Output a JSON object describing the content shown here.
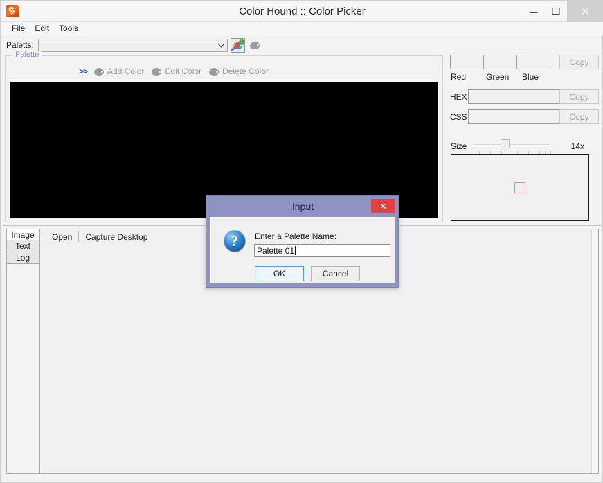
{
  "window": {
    "title": "Color Hound :: Color Picker",
    "icon": "app-dog-icon",
    "controls": {
      "minimize": "–",
      "maximize": "□",
      "close": "✕"
    }
  },
  "menubar": {
    "items": [
      "File",
      "Edit",
      "Tools"
    ]
  },
  "palette_bar": {
    "label": "Paletts:",
    "combo_value": "",
    "combo_arrow_icon": "chevron-down-icon",
    "buttons": [
      {
        "name": "new-palette-button",
        "icon": "palette-add-icon",
        "state": "active"
      },
      {
        "name": "delete-palette-button",
        "icon": "palette-icon",
        "state": "disabled"
      }
    ]
  },
  "palette_group": {
    "legend": "Palette",
    "expander": ">>",
    "actions": [
      {
        "label": "Add Color",
        "icon": "palette-icon",
        "enabled": false
      },
      {
        "label": "Edit Color",
        "icon": "palette-icon",
        "enabled": false
      },
      {
        "label": "Delete Color",
        "icon": "palette-icon",
        "enabled": false
      }
    ],
    "swatch_area_color": "#000000"
  },
  "color_panel": {
    "rgb": {
      "red": {
        "label": "Red",
        "value": ""
      },
      "green": {
        "label": "Green",
        "value": ""
      },
      "blue": {
        "label": "Blue",
        "value": ""
      },
      "copy_label": "Copy"
    },
    "hex": {
      "label": "HEX",
      "value": "",
      "copy_label": "Copy"
    },
    "css": {
      "label": "CSS",
      "value": "",
      "copy_label": "Copy"
    },
    "size": {
      "label": "Size",
      "value": "14x"
    },
    "preview": {
      "name": "magnifier-preview",
      "cursor_color": "#e08b8b"
    }
  },
  "bottom": {
    "vtabs": [
      {
        "label": "Image",
        "selected": true
      },
      {
        "label": "Text",
        "selected": false
      },
      {
        "label": "Log",
        "selected": false
      }
    ],
    "toolbar": [
      {
        "label": "Open"
      },
      {
        "label": "Capture Desktop"
      }
    ]
  },
  "dialog": {
    "title": "Input",
    "close_glyph": "✕",
    "icon": "question-icon",
    "icon_glyph": "?",
    "prompt": "Enter a Palette Name:",
    "input_value": "Palette 01",
    "input_placeholder": "",
    "ok_label": "OK",
    "cancel_label": "Cancel"
  },
  "colors": {
    "accent_blue": "#4ea0e8",
    "dialog_chrome": "#8f93c4",
    "close_red": "#e04343",
    "legend_purple": "#8f8fc8",
    "chevron_blue": "#2a4fb0",
    "disabled_text": "#9a9a9a"
  }
}
